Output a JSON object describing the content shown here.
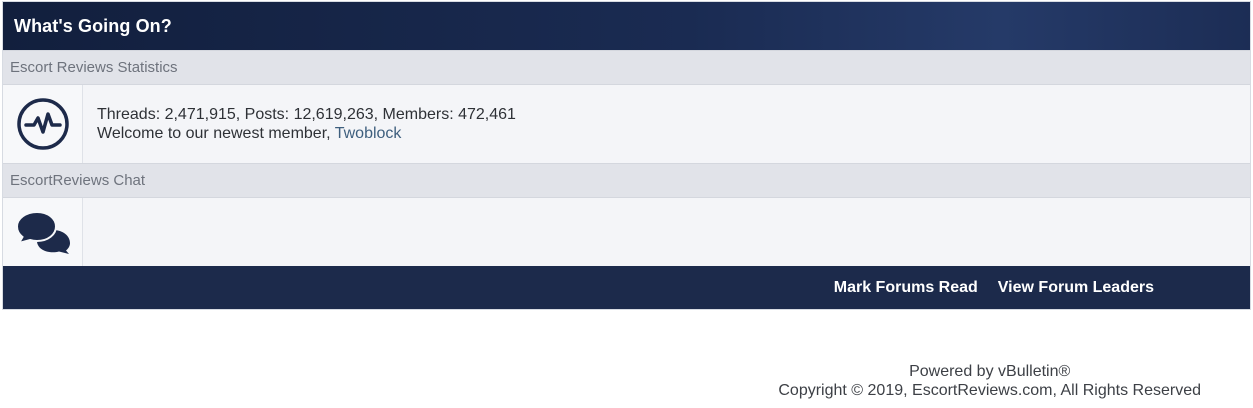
{
  "panel": {
    "title": "What's Going On?"
  },
  "stats_section": {
    "heading": "Escort Reviews Statistics",
    "icon": "activity-pulse-icon",
    "stats_text": "Threads: 2,471,915, Posts: 12,619,263, Members: 472,461",
    "welcome_prefix": "Welcome to our newest member, ",
    "newest_member": "Twoblock"
  },
  "chat_section": {
    "heading": "EscortReviews Chat",
    "icon": "chat-bubbles-icon"
  },
  "footer_bar": {
    "mark_read": "Mark Forums Read",
    "forum_leaders": "View Forum Leaders"
  },
  "credits": {
    "powered_by": "Powered by vBulletin®",
    "copyright": "Copyright © 2019, EscortReviews.com, All Rights Reserved"
  },
  "colors": {
    "header_dark": "#121f3d",
    "footer_bar": "#1c2a4b",
    "section_bg": "#e1e3e9",
    "link": "#3e5f7e"
  }
}
